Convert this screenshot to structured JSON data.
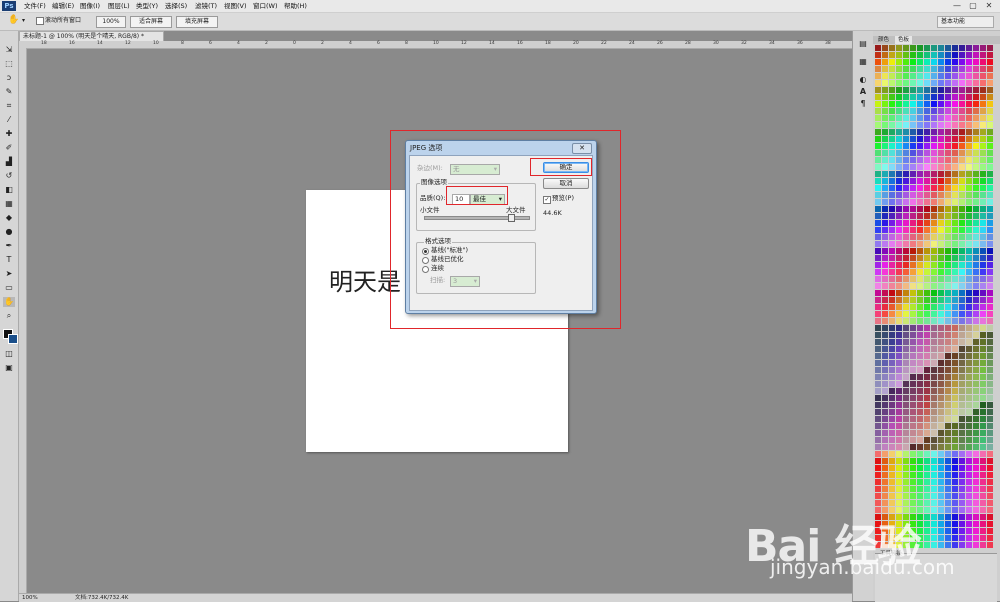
{
  "app": {
    "logo": "Ps"
  },
  "menubar": {
    "items": [
      "文件(F)",
      "编辑(E)",
      "图像(I)",
      "图层(L)",
      "类型(Y)",
      "选择(S)",
      "滤镜(T)",
      "视图(V)",
      "窗口(W)",
      "帮助(H)"
    ],
    "window_buttons": [
      "—",
      "▢",
      "✕"
    ]
  },
  "options": {
    "scroll_all_label": "滚动所有窗口",
    "zoom_value": "100%",
    "fit_screen": "适合屏幕",
    "fill_screen": "填充屏幕",
    "workspace": "基本功能"
  },
  "document": {
    "tab_title": "未标题-1 @ 100% (明天是个晴天, RGB/8) *",
    "canvas_text": "明天是",
    "ruler_numbers": [
      "18",
      "16",
      "14",
      "12",
      "10",
      "8",
      "6",
      "4",
      "2",
      "0",
      "2",
      "4",
      "6",
      "8",
      "10",
      "12",
      "14",
      "16",
      "18",
      "20",
      "22",
      "24",
      "26",
      "28",
      "30",
      "32",
      "34",
      "36",
      "38"
    ],
    "zoom": "100%",
    "status": "文档:732.4K/732.4K"
  },
  "dialog": {
    "title": "JPEG 选项",
    "close": "✕",
    "matte_label": "杂边(M):",
    "matte_value": "无",
    "image_options_label": "图像选项",
    "quality_label": "品质(Q):",
    "quality_value": "10",
    "quality_preset": "最佳",
    "small_file": "小文件",
    "large_file": "大文件",
    "quality_fraction": 0.83,
    "format_options_label": "格式选项",
    "format_baseline_standard": "基线(\"标准\")",
    "format_baseline_optimized": "基线已优化",
    "format_progressive": "连续",
    "scans_label": "扫描:",
    "scans_value": "3",
    "ok": "确定",
    "cancel": "取消",
    "preview": "预览(P)",
    "file_size": "44.6K"
  },
  "right_panel": {
    "tabs": [
      "颜色",
      "色板"
    ],
    "styles_title": "工具预设"
  },
  "watermark": {
    "logo": "Bai 经验",
    "url": "jingyan.baidu.com"
  },
  "colors": {
    "accent_red": "#e0262b",
    "dialog_frame": "#bcd3ec",
    "canvas_bg": "#8a8a8a"
  }
}
